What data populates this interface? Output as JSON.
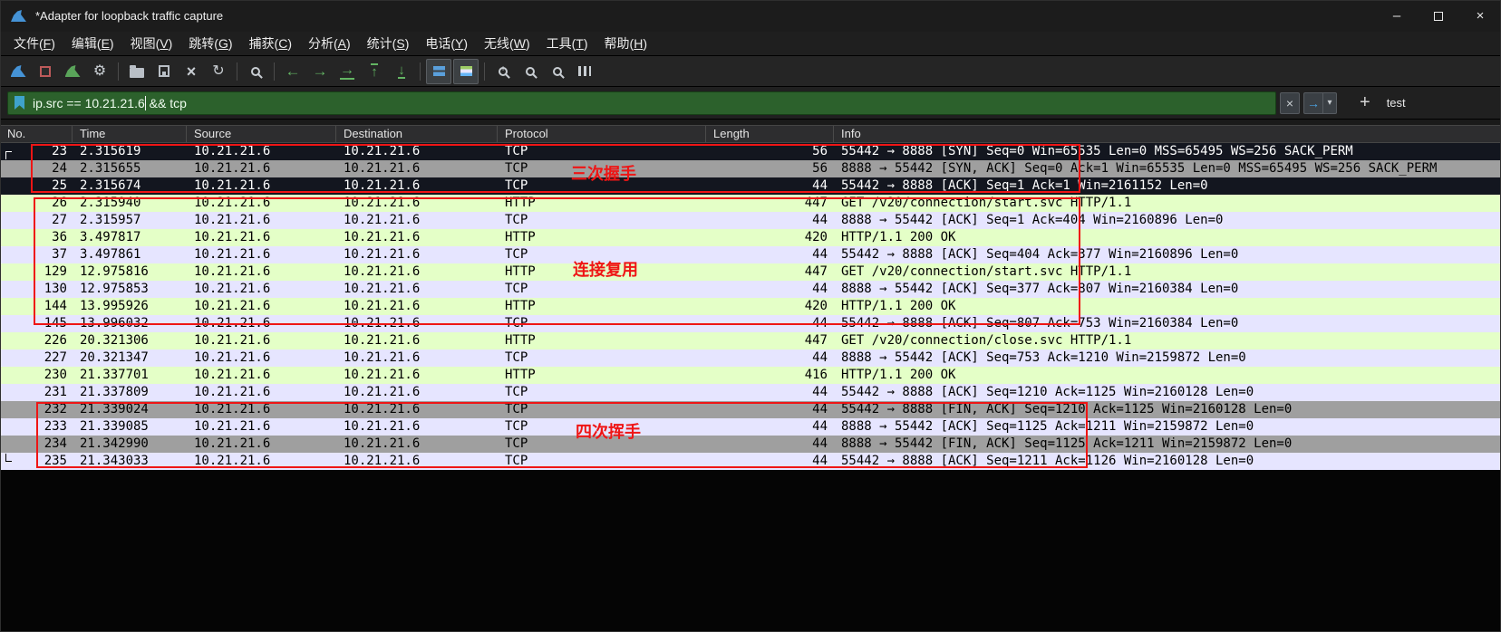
{
  "window": {
    "title": "*Adapter for loopback traffic capture",
    "controls": {
      "minimize": "–",
      "close": "×"
    }
  },
  "menu": {
    "items": [
      {
        "name": "file",
        "label": "文件(F)"
      },
      {
        "name": "edit",
        "label": "编辑(E)"
      },
      {
        "name": "view",
        "label": "视图(V)"
      },
      {
        "name": "go",
        "label": "跳转(G)"
      },
      {
        "name": "capture",
        "label": "捕获(C)"
      },
      {
        "name": "analyze",
        "label": "分析(A)"
      },
      {
        "name": "statistics",
        "label": "统计(S)"
      },
      {
        "name": "telephony",
        "label": "电话(Y)"
      },
      {
        "name": "wireless",
        "label": "无线(W)"
      },
      {
        "name": "tools",
        "label": "工具(T)"
      },
      {
        "name": "help",
        "label": "帮助(H)"
      }
    ]
  },
  "toolbar": {
    "buttons": [
      {
        "name": "start-capture"
      },
      {
        "name": "stop-capture"
      },
      {
        "name": "restart-capture"
      },
      {
        "name": "capture-options"
      },
      {
        "separator": true
      },
      {
        "name": "open-file"
      },
      {
        "name": "save-file"
      },
      {
        "name": "close-file"
      },
      {
        "name": "reload-file"
      },
      {
        "separator": true
      },
      {
        "name": "find-packet"
      },
      {
        "separator": true
      },
      {
        "name": "go-back"
      },
      {
        "name": "go-forward"
      },
      {
        "name": "go-to-packet"
      },
      {
        "name": "go-to-top"
      },
      {
        "name": "go-to-bottom"
      },
      {
        "separator": true
      },
      {
        "name": "auto-scroll",
        "pressed": true
      },
      {
        "name": "colorize",
        "pressed": true
      },
      {
        "separator": true
      },
      {
        "name": "zoom-in"
      },
      {
        "name": "zoom-out"
      },
      {
        "name": "zoom-reset"
      },
      {
        "name": "resize-columns"
      }
    ]
  },
  "filter": {
    "text_before_cursor": "ip.src == 10.21.21.6",
    "text_after_cursor": " && tcp",
    "clear_glyph": "×",
    "apply_glyph": "→",
    "dropdown_glyph": "▾",
    "add_glyph": "+",
    "shortcut_label": "test"
  },
  "packet_list": {
    "columns": [
      {
        "key": "no",
        "label": "No."
      },
      {
        "key": "time",
        "label": "Time"
      },
      {
        "key": "source",
        "label": "Source"
      },
      {
        "key": "destination",
        "label": "Destination"
      },
      {
        "key": "protocol",
        "label": "Protocol"
      },
      {
        "key": "length",
        "label": "Length"
      },
      {
        "key": "info",
        "label": "Info"
      }
    ],
    "rows": [
      {
        "no": "23",
        "time": "2.315619",
        "source": "10.21.21.6",
        "destination": "10.21.21.6",
        "protocol": "TCP",
        "length": "56",
        "info": "55442 → 8888 [SYN] Seq=0 Win=65535 Len=0 MSS=65495 WS=256 SACK_PERM",
        "color": "selected",
        "gutter": "first"
      },
      {
        "no": "24",
        "time": "2.315655",
        "source": "10.21.21.6",
        "destination": "10.21.21.6",
        "protocol": "TCP",
        "length": "56",
        "info": "8888 → 55442 [SYN, ACK] Seq=0 Ack=1 Win=65535 Len=0 MSS=65495 WS=256 SACK_PERM",
        "color": "gray"
      },
      {
        "no": "25",
        "time": "2.315674",
        "source": "10.21.21.6",
        "destination": "10.21.21.6",
        "protocol": "TCP",
        "length": "44",
        "info": "55442 → 8888 [ACK] Seq=1 Ack=1 Win=2161152 Len=0",
        "color": "selected"
      },
      {
        "no": "26",
        "time": "2.315940",
        "source": "10.21.21.6",
        "destination": "10.21.21.6",
        "protocol": "HTTP",
        "length": "447",
        "info": "GET /v20/connection/start.svc HTTP/1.1",
        "color": "http"
      },
      {
        "no": "27",
        "time": "2.315957",
        "source": "10.21.21.6",
        "destination": "10.21.21.6",
        "protocol": "TCP",
        "length": "44",
        "info": "8888 → 55442 [ACK] Seq=1 Ack=404 Win=2160896 Len=0",
        "color": "tcp"
      },
      {
        "no": "36",
        "time": "3.497817",
        "source": "10.21.21.6",
        "destination": "10.21.21.6",
        "protocol": "HTTP",
        "length": "420",
        "info": "HTTP/1.1 200 OK",
        "color": "http"
      },
      {
        "no": "37",
        "time": "3.497861",
        "source": "10.21.21.6",
        "destination": "10.21.21.6",
        "protocol": "TCP",
        "length": "44",
        "info": "55442 → 8888 [ACK] Seq=404 Ack=377 Win=2160896 Len=0",
        "color": "tcp"
      },
      {
        "no": "129",
        "time": "12.975816",
        "source": "10.21.21.6",
        "destination": "10.21.21.6",
        "protocol": "HTTP",
        "length": "447",
        "info": "GET /v20/connection/start.svc HTTP/1.1",
        "color": "http"
      },
      {
        "no": "130",
        "time": "12.975853",
        "source": "10.21.21.6",
        "destination": "10.21.21.6",
        "protocol": "TCP",
        "length": "44",
        "info": "8888 → 55442 [ACK] Seq=377 Ack=807 Win=2160384 Len=0",
        "color": "tcp"
      },
      {
        "no": "144",
        "time": "13.995926",
        "source": "10.21.21.6",
        "destination": "10.21.21.6",
        "protocol": "HTTP",
        "length": "420",
        "info": "HTTP/1.1 200 OK",
        "color": "http"
      },
      {
        "no": "145",
        "time": "13.996032",
        "source": "10.21.21.6",
        "destination": "10.21.21.6",
        "protocol": "TCP",
        "length": "44",
        "info": "55442 → 8888 [ACK] Seq=807 Ack=753 Win=2160384 Len=0",
        "color": "tcp"
      },
      {
        "no": "226",
        "time": "20.321306",
        "source": "10.21.21.6",
        "destination": "10.21.21.6",
        "protocol": "HTTP",
        "length": "447",
        "info": "GET /v20/connection/close.svc HTTP/1.1",
        "color": "http"
      },
      {
        "no": "227",
        "time": "20.321347",
        "source": "10.21.21.6",
        "destination": "10.21.21.6",
        "protocol": "TCP",
        "length": "44",
        "info": "8888 → 55442 [ACK] Seq=753 Ack=1210 Win=2159872 Len=0",
        "color": "tcp"
      },
      {
        "no": "230",
        "time": "21.337701",
        "source": "10.21.21.6",
        "destination": "10.21.21.6",
        "protocol": "HTTP",
        "length": "416",
        "info": "HTTP/1.1 200 OK",
        "color": "http"
      },
      {
        "no": "231",
        "time": "21.337809",
        "source": "10.21.21.6",
        "destination": "10.21.21.6",
        "protocol": "TCP",
        "length": "44",
        "info": "55442 → 8888 [ACK] Seq=1210 Ack=1125 Win=2160128 Len=0",
        "color": "tcp"
      },
      {
        "no": "232",
        "time": "21.339024",
        "source": "10.21.21.6",
        "destination": "10.21.21.6",
        "protocol": "TCP",
        "length": "44",
        "info": "55442 → 8888 [FIN, ACK] Seq=1210 Ack=1125 Win=2160128 Len=0",
        "color": "gray"
      },
      {
        "no": "233",
        "time": "21.339085",
        "source": "10.21.21.6",
        "destination": "10.21.21.6",
        "protocol": "TCP",
        "length": "44",
        "info": "8888 → 55442 [ACK] Seq=1125 Ack=1211 Win=2159872 Len=0",
        "color": "tcp"
      },
      {
        "no": "234",
        "time": "21.342990",
        "source": "10.21.21.6",
        "destination": "10.21.21.6",
        "protocol": "TCP",
        "length": "44",
        "info": "8888 → 55442 [FIN, ACK] Seq=1125 Ack=1211 Win=2159872 Len=0",
        "color": "gray"
      },
      {
        "no": "235",
        "time": "21.343033",
        "source": "10.21.21.6",
        "destination": "10.21.21.6",
        "protocol": "TCP",
        "length": "44",
        "info": "55442 → 8888 [ACK] Seq=1211 Ack=1126 Win=2160128 Len=0",
        "color": "tcp",
        "gutter": "last"
      }
    ]
  },
  "annotations": [
    {
      "label": "三次握手"
    },
    {
      "label": "连接复用"
    },
    {
      "label": "四次挥手"
    }
  ],
  "colors": {
    "filter_valid_background": "#2c612c",
    "row_http_background": "#e4ffc7",
    "row_tcp_background": "#e6e5ff",
    "row_syn_fin_background": "#9f9f9f",
    "row_selected_background": "#13161f",
    "annotation_red": "#ef1515",
    "toolbar_accent_blue": "#4593d6"
  }
}
